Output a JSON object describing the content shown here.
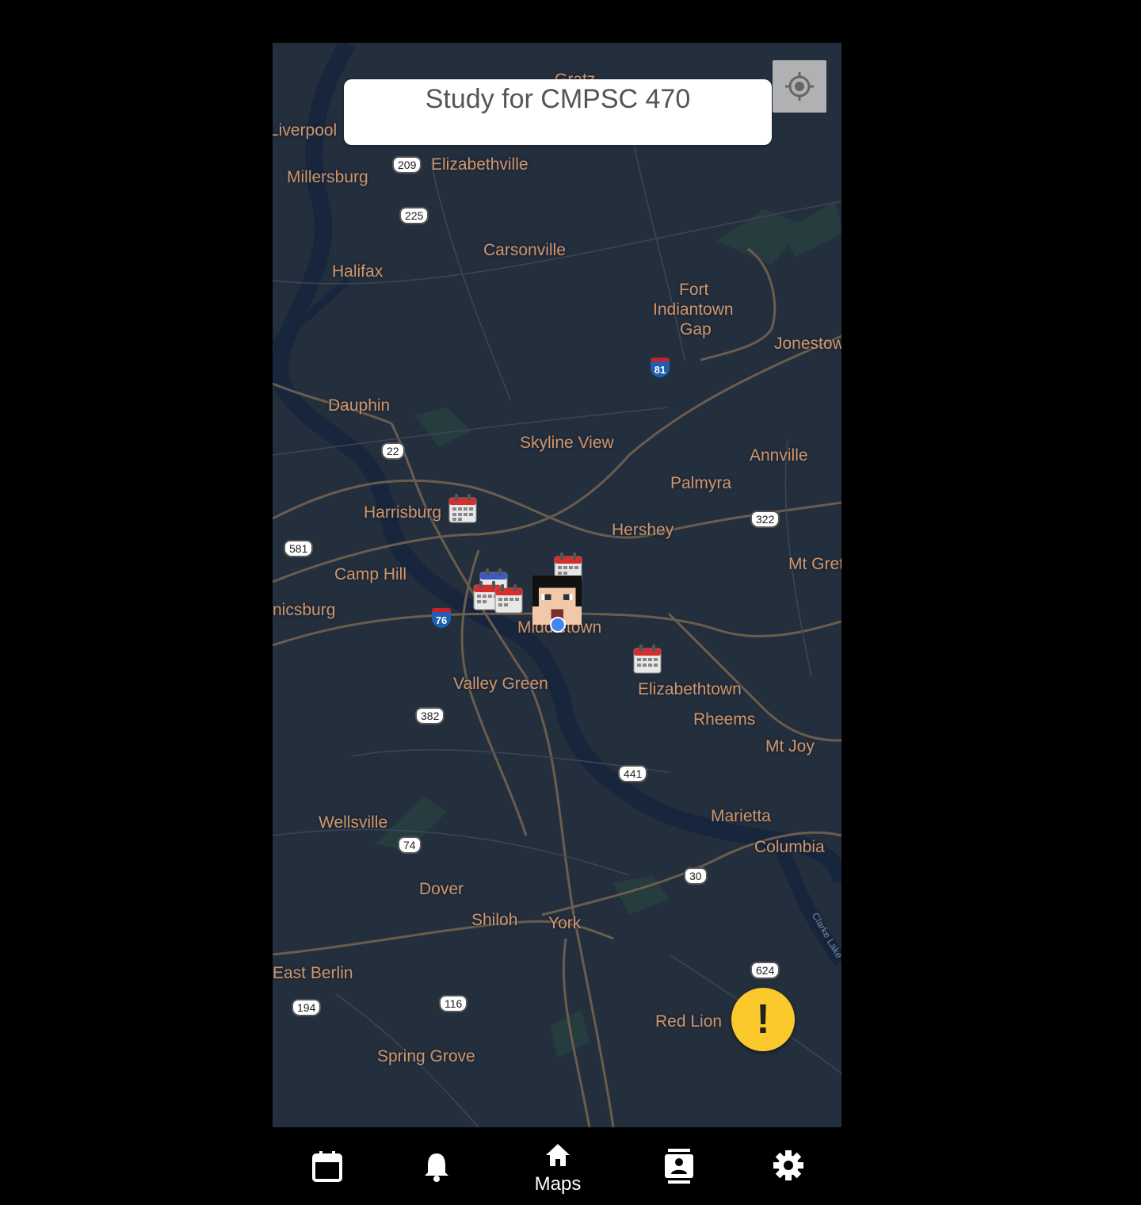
{
  "search": {
    "text": "Study for CMPSC 470"
  },
  "map": {
    "places": [
      {
        "key": "gratz",
        "label": "Gratz"
      },
      {
        "key": "liverpool",
        "label": "Liverpool"
      },
      {
        "key": "millersburg",
        "label": "Millersburg"
      },
      {
        "key": "elizabethville",
        "label": "Elizabethville"
      },
      {
        "key": "carsonville",
        "label": "Carsonville"
      },
      {
        "key": "halifax",
        "label": "Halifax"
      },
      {
        "key": "fort",
        "label": "Fort"
      },
      {
        "key": "indiantown",
        "label": "Indiantown"
      },
      {
        "key": "gap",
        "label": "Gap"
      },
      {
        "key": "jonestown",
        "label": "Jonestow"
      },
      {
        "key": "dauphin",
        "label": "Dauphin"
      },
      {
        "key": "skyline",
        "label": "Skyline View"
      },
      {
        "key": "annville",
        "label": "Annville"
      },
      {
        "key": "palmyra",
        "label": "Palmyra"
      },
      {
        "key": "harrisburg",
        "label": "Harrisburg"
      },
      {
        "key": "hershey",
        "label": "Hershey"
      },
      {
        "key": "mtgretna",
        "label": "Mt Gret"
      },
      {
        "key": "camphill",
        "label": "Camp Hill"
      },
      {
        "key": "mechanicsburg",
        "label": "nicsburg"
      },
      {
        "key": "middletown",
        "label": "Middletown"
      },
      {
        "key": "elizabethtown",
        "label": "Elizabethtown"
      },
      {
        "key": "valleygreen",
        "label": "Valley Green"
      },
      {
        "key": "rheems",
        "label": "Rheems"
      },
      {
        "key": "mtjoy",
        "label": "Mt Joy"
      },
      {
        "key": "marietta",
        "label": "Marietta"
      },
      {
        "key": "wellsville",
        "label": "Wellsville"
      },
      {
        "key": "columbia",
        "label": "Columbia"
      },
      {
        "key": "dover",
        "label": "Dover"
      },
      {
        "key": "shiloh",
        "label": "Shiloh"
      },
      {
        "key": "york",
        "label": "York"
      },
      {
        "key": "eastberlin",
        "label": "East Berlin"
      },
      {
        "key": "redlion",
        "label": "Red Lion"
      },
      {
        "key": "springgrove",
        "label": "Spring Grove"
      }
    ],
    "shields": [
      "209",
      "225",
      "22",
      "581",
      "322",
      "382",
      "441",
      "74",
      "30",
      "624",
      "194",
      "116"
    ],
    "interstates": [
      "81",
      "76"
    ],
    "water_label": "Clarke Lake"
  },
  "alert": {
    "symbol": "!"
  },
  "nav": {
    "items": [
      {
        "icon": "calendar-icon",
        "label": ""
      },
      {
        "icon": "bell-icon",
        "label": ""
      },
      {
        "icon": "home-icon",
        "label": "Maps"
      },
      {
        "icon": "contacts-icon",
        "label": ""
      },
      {
        "icon": "gear-icon",
        "label": ""
      }
    ]
  },
  "colors": {
    "map_bg": "#242f3e",
    "road": "#6b5d4d",
    "water": "#17263c",
    "label": "#d59563",
    "alert": "#fbc92c",
    "user_dot": "#4285f4"
  }
}
